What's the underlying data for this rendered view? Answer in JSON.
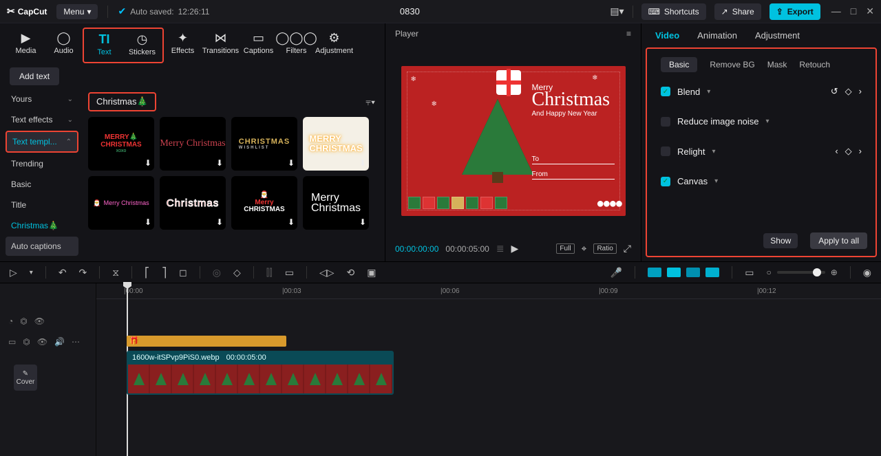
{
  "topbar": {
    "brand": "CapCut",
    "menu_label": "Menu",
    "autosave_label": "Auto saved:",
    "autosave_time": "12:26:11",
    "project_title": "0830",
    "shortcuts_label": "Shortcuts",
    "share_label": "Share",
    "export_label": "Export"
  },
  "icontabs": {
    "media": "Media",
    "audio": "Audio",
    "text": "Text",
    "stickers": "Stickers",
    "effects": "Effects",
    "transitions": "Transitions",
    "captions": "Captions",
    "filters": "Filters",
    "adjustment": "Adjustment"
  },
  "addtext": "Add text",
  "cats": {
    "yours": "Yours",
    "text_effects": "Text effects",
    "text_templ": "Text templ...",
    "trending": "Trending",
    "basic": "Basic",
    "title": "Title",
    "christmas": "Christmas🎄",
    "auto_captions": "Auto captions"
  },
  "search_term": "Christmas🎄",
  "thumbs": {
    "t1a": "MERRY",
    "t1b": "CHRISTMAS",
    "t1c": "xoxo",
    "t2": "Merry Christmas",
    "t3a": "CHRISTMAS",
    "t3b": "WISHLIST",
    "t4a": "MERRY",
    "t4b": "CHRISTMAS",
    "t5": "Merry Christmas",
    "t6": "Christmas",
    "t7a": "Merry",
    "t7b": "CHRISTMAS",
    "t8a": "Merry",
    "t8b": "Christmas"
  },
  "player": {
    "title": "Player",
    "merry": "Merry",
    "christmas": "Christmas",
    "happy": "And Happy New Year",
    "to": "To",
    "from": "From",
    "cur_time": "00:00:00:00",
    "dur_time": "00:00:05:00",
    "full": "Full",
    "ratio": "Ratio"
  },
  "rpanel": {
    "tab_video": "Video",
    "tab_animation": "Animation",
    "tab_adjustment": "Adjustment",
    "sub_basic": "Basic",
    "sub_removebg": "Remove BG",
    "sub_mask": "Mask",
    "sub_retouch": "Retouch",
    "blend": "Blend",
    "reduce": "Reduce image noise",
    "relight": "Relight",
    "canvas": "Canvas",
    "show": "Show",
    "apply": "Apply to all"
  },
  "ruler": {
    "t0": "|00:00",
    "t3": "|00:03",
    "t6": "|00:06",
    "t9": "|00:09",
    "t12": "|00:12"
  },
  "clip": {
    "name": "1600w-itSPvp9PiS0.webp",
    "dur": "00:00:05:00"
  },
  "cover": "Cover"
}
